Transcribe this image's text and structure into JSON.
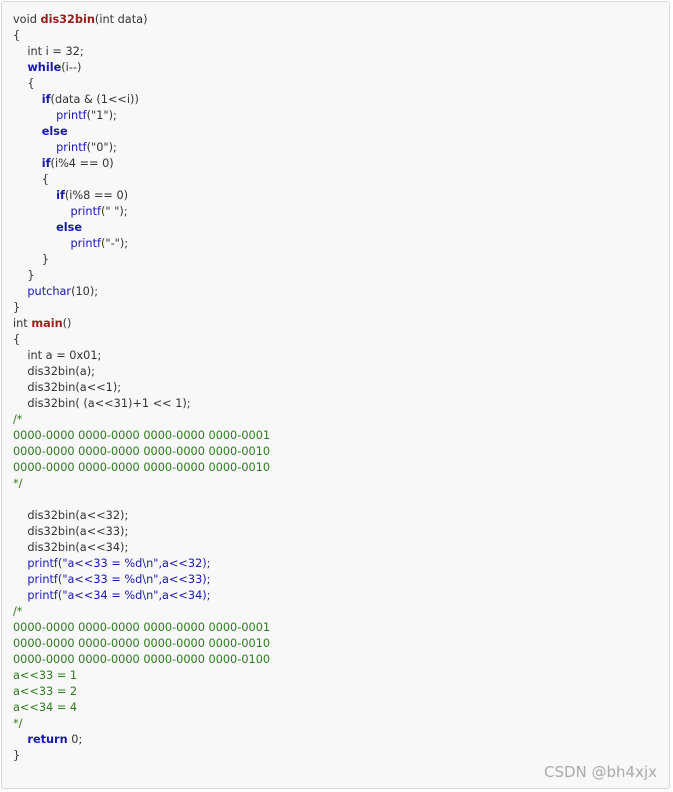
{
  "code_lines": [
    [
      {
        "t": "tx",
        "v": "void "
      },
      {
        "t": "fn",
        "v": "dis32bin"
      },
      {
        "t": "tx",
        "v": "(int data)"
      }
    ],
    [
      {
        "t": "tx",
        "v": "{"
      }
    ],
    [
      {
        "t": "tx",
        "v": "    int i = 32;"
      }
    ],
    [
      {
        "t": "tx",
        "v": "    "
      },
      {
        "t": "kw",
        "v": "while"
      },
      {
        "t": "tx",
        "v": "(i--)"
      }
    ],
    [
      {
        "t": "tx",
        "v": "    {"
      }
    ],
    [
      {
        "t": "tx",
        "v": "        "
      },
      {
        "t": "kw",
        "v": "if"
      },
      {
        "t": "tx",
        "v": "(data & (1<<i))"
      }
    ],
    [
      {
        "t": "tx",
        "v": "            "
      },
      {
        "t": "fn2",
        "v": "printf"
      },
      {
        "t": "tx",
        "v": "(\"1\");"
      }
    ],
    [
      {
        "t": "tx",
        "v": "        "
      },
      {
        "t": "kw",
        "v": "else"
      }
    ],
    [
      {
        "t": "tx",
        "v": "            "
      },
      {
        "t": "fn2",
        "v": "printf"
      },
      {
        "t": "tx",
        "v": "(\"0\");"
      }
    ],
    [
      {
        "t": "tx",
        "v": "        "
      },
      {
        "t": "kw",
        "v": "if"
      },
      {
        "t": "tx",
        "v": "(i%4 == 0)"
      }
    ],
    [
      {
        "t": "tx",
        "v": "        {"
      }
    ],
    [
      {
        "t": "tx",
        "v": "            "
      },
      {
        "t": "kw",
        "v": "if"
      },
      {
        "t": "tx",
        "v": "(i%8 == 0)"
      }
    ],
    [
      {
        "t": "tx",
        "v": "                "
      },
      {
        "t": "fn2",
        "v": "printf"
      },
      {
        "t": "tx",
        "v": "(\" \");"
      }
    ],
    [
      {
        "t": "tx",
        "v": "            "
      },
      {
        "t": "kw",
        "v": "else"
      }
    ],
    [
      {
        "t": "tx",
        "v": "                "
      },
      {
        "t": "fn2",
        "v": "printf"
      },
      {
        "t": "tx",
        "v": "(\"-\");"
      }
    ],
    [
      {
        "t": "tx",
        "v": "        }"
      }
    ],
    [
      {
        "t": "tx",
        "v": "    }"
      }
    ],
    [
      {
        "t": "tx",
        "v": "    "
      },
      {
        "t": "fn2",
        "v": "putchar"
      },
      {
        "t": "tx",
        "v": "(10);"
      }
    ],
    [
      {
        "t": "tx",
        "v": "}"
      }
    ],
    [
      {
        "t": "tx",
        "v": "int "
      },
      {
        "t": "fn",
        "v": "main"
      },
      {
        "t": "tx",
        "v": "()"
      }
    ],
    [
      {
        "t": "tx",
        "v": "{"
      }
    ],
    [
      {
        "t": "tx",
        "v": "    int a = 0x01;"
      }
    ],
    [
      {
        "t": "tx",
        "v": "    dis32bin(a);"
      }
    ],
    [
      {
        "t": "tx",
        "v": "    dis32bin(a<<1);"
      }
    ],
    [
      {
        "t": "tx",
        "v": "    dis32bin( (a<<31)+1 << 1);"
      }
    ],
    [
      {
        "t": "cm",
        "v": "/*"
      }
    ],
    [
      {
        "t": "cm",
        "v": "0000-0000 0000-0000 0000-0000 0000-0001"
      }
    ],
    [
      {
        "t": "cm",
        "v": "0000-0000 0000-0000 0000-0000 0000-0010"
      }
    ],
    [
      {
        "t": "cm",
        "v": "0000-0000 0000-0000 0000-0000 0000-0010"
      }
    ],
    [
      {
        "t": "cm",
        "v": "*/"
      }
    ],
    [
      {
        "t": "tx",
        "v": ""
      }
    ],
    [
      {
        "t": "tx",
        "v": "    dis32bin(a<<32);"
      }
    ],
    [
      {
        "t": "tx",
        "v": "    dis32bin(a<<33);"
      }
    ],
    [
      {
        "t": "tx",
        "v": "    dis32bin(a<<34);"
      }
    ],
    [
      {
        "t": "tx",
        "v": "    "
      },
      {
        "t": "fn2",
        "v": "printf"
      },
      {
        "t": "str",
        "v": "(\"a<<33 = %d\\n\",a<<32);"
      }
    ],
    [
      {
        "t": "tx",
        "v": "    "
      },
      {
        "t": "fn2",
        "v": "printf"
      },
      {
        "t": "str",
        "v": "(\"a<<33 = %d\\n\",a<<33);"
      }
    ],
    [
      {
        "t": "tx",
        "v": "    "
      },
      {
        "t": "fn2",
        "v": "printf"
      },
      {
        "t": "str",
        "v": "(\"a<<34 = %d\\n\",a<<34);"
      }
    ],
    [
      {
        "t": "cm",
        "v": "/*"
      }
    ],
    [
      {
        "t": "cm",
        "v": "0000-0000 0000-0000 0000-0000 0000-0001"
      }
    ],
    [
      {
        "t": "cm",
        "v": "0000-0000 0000-0000 0000-0000 0000-0010"
      }
    ],
    [
      {
        "t": "cm",
        "v": "0000-0000 0000-0000 0000-0000 0000-0100"
      }
    ],
    [
      {
        "t": "cm",
        "v": "a<<33 = 1"
      }
    ],
    [
      {
        "t": "cm",
        "v": "a<<33 = 2"
      }
    ],
    [
      {
        "t": "cm",
        "v": "a<<34 = 4"
      }
    ],
    [
      {
        "t": "cm",
        "v": "*/"
      }
    ],
    [
      {
        "t": "tx",
        "v": "    "
      },
      {
        "t": "kw",
        "v": "return"
      },
      {
        "t": "tx",
        "v": " 0;"
      }
    ],
    [
      {
        "t": "tx",
        "v": "}"
      }
    ]
  ],
  "watermark": "CSDN @bh4xjx"
}
